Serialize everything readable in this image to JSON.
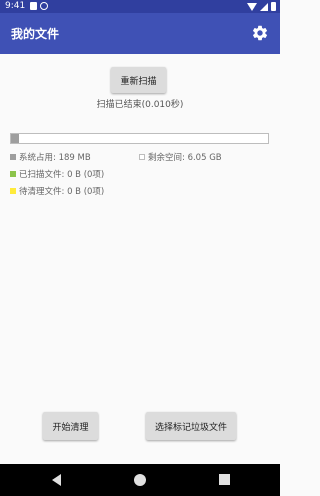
{
  "status_bar": {
    "time": "9:41"
  },
  "app_bar": {
    "title": "我的文件",
    "settings_icon": "gear-icon"
  },
  "scan": {
    "rescan_label": "重新扫描",
    "status_text": "扫描已结束(0.010秒)"
  },
  "storage": {
    "used_fraction": 0.03,
    "system_used": "系统占用: 189 MB",
    "free_space": "剩余空间: 6.05 GB",
    "scanned_files": "已扫描文件: 0 B (0项)",
    "pending_files": "待清理文件: 0 B (0项)",
    "colors": {
      "system": "#9e9e9e",
      "free": "#ffffff",
      "scanned": "#8bc34a",
      "pending": "#ffeb3b"
    }
  },
  "actions": {
    "clean_label": "开始清理",
    "select_label": "选择标记垃圾文件"
  },
  "theme": {
    "status_bar": "#303f9f",
    "app_bar": "#3f51b5"
  }
}
